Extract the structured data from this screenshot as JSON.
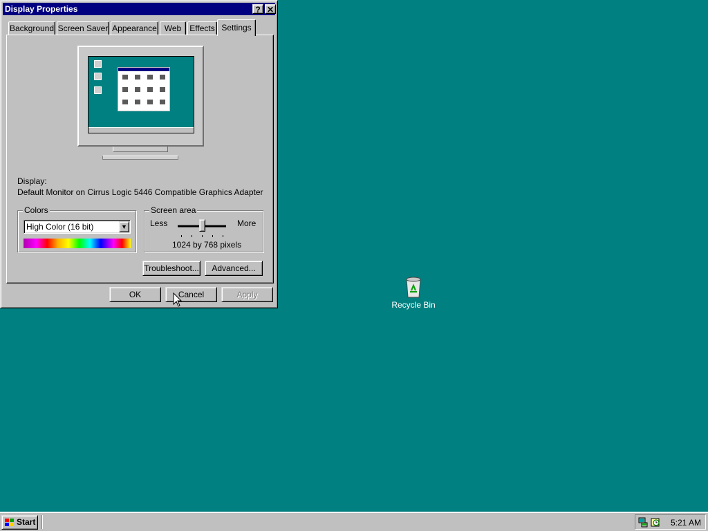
{
  "colors": {
    "desktop": "#008080",
    "title_bar": "#000080",
    "face": "#c0c0c0"
  },
  "dialog": {
    "title": "Display Properties",
    "help_icon": "question-mark-icon",
    "close_icon": "close-icon",
    "tabs": [
      {
        "label": "Background",
        "active": false
      },
      {
        "label": "Screen Saver",
        "active": false
      },
      {
        "label": "Appearance",
        "active": false
      },
      {
        "label": "Web",
        "active": false
      },
      {
        "label": "Effects",
        "active": false
      },
      {
        "label": "Settings",
        "active": true
      }
    ],
    "display_label": "Display:",
    "display_device": "Default Monitor on Cirrus Logic 5446 Compatible Graphics Adapter",
    "colors_group": {
      "title": "Colors",
      "selected": "High Color (16 bit)"
    },
    "screen_area_group": {
      "title": "Screen area",
      "less": "Less",
      "more": "More",
      "value_text": "1024 by 768 pixels",
      "slider_position": 0.5
    },
    "troubleshoot_label": "Troubleshoot...",
    "advanced_label": "Advanced...",
    "ok_label": "OK",
    "cancel_label": "Cancel",
    "apply_label": "Apply"
  },
  "desktop": {
    "recycle_bin_label": "Recycle Bin",
    "recycle_bin_icon": "recycle-bin-icon"
  },
  "taskbar": {
    "start_label": "Start",
    "start_icon": "windows-logo-icon",
    "tray_icons": [
      "network-icon",
      "scheduler-icon"
    ],
    "clock": "5:21 AM"
  }
}
